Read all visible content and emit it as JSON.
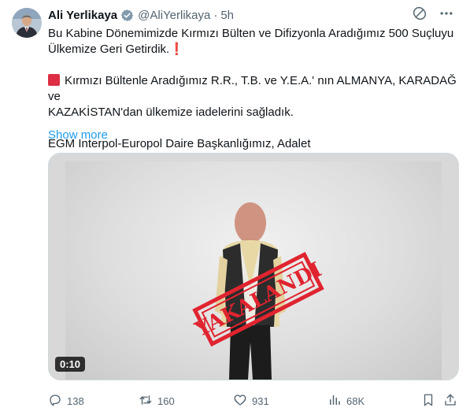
{
  "tweet": {
    "author_name": "Ali Yerlikaya",
    "handle": "@AliYerlikaya",
    "separator": "·",
    "time": "5h",
    "text_line1": "Bu Kabine Dönemimizde Kırmızı Bülten ve Difizyonla Aradığımız 500 Suçluyu",
    "text_line2": "Ülkemize Geri Getirdik.❗",
    "text_para2": "Kırmızı Bültenle Aradığımız R.R., T.B. ve Y.E.A.' nın ALMANYA, KARADAĞ ve\nKAZAKİSTAN'dan ülkemize iadelerini sağladık.",
    "text_para3": "EGM Interpol-Europol Daire Başkanlığımız, Adalet",
    "show_more": "Show more"
  },
  "media": {
    "stamp_text": "YAKALANDI",
    "duration": "0:10"
  },
  "actions": {
    "replies": "138",
    "reposts": "160",
    "likes": "931",
    "views": "68K"
  },
  "colors": {
    "accent": "#1d9bf0",
    "stamp": "#e0242f",
    "text": "#0f1419",
    "muted": "#536471"
  },
  "icons": [
    "verified-badge-icon",
    "grok-icon",
    "more-icon",
    "reply-icon",
    "repost-icon",
    "like-icon",
    "views-icon",
    "bookmark-icon",
    "share-icon"
  ]
}
